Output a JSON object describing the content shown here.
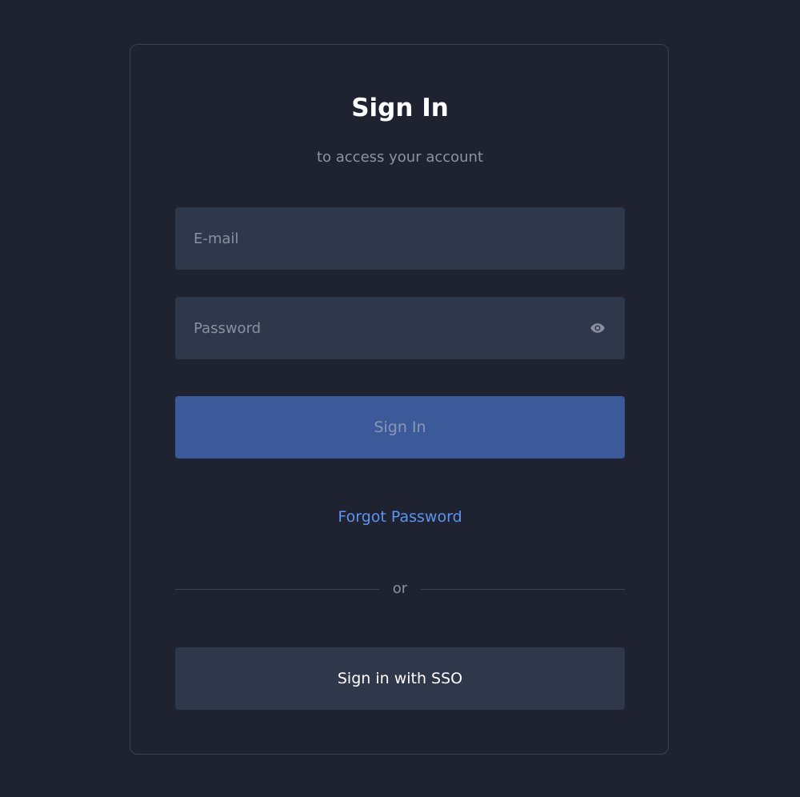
{
  "signin": {
    "title": "Sign In",
    "subtitle": "to access your account",
    "email": {
      "placeholder": "E-mail",
      "value": ""
    },
    "password": {
      "placeholder": "Password",
      "value": "",
      "toggle_icon": "eye-icon"
    },
    "submit_label": "Sign In",
    "forgot_label": "Forgot Password",
    "divider_label": "or",
    "sso_label": "Sign in with SSO"
  },
  "colors": {
    "background": "#1f2231",
    "card_border": "#3a4256",
    "field_bg": "#2f374a",
    "primary_button": "#3c5a9a",
    "link": "#5b95ee"
  }
}
